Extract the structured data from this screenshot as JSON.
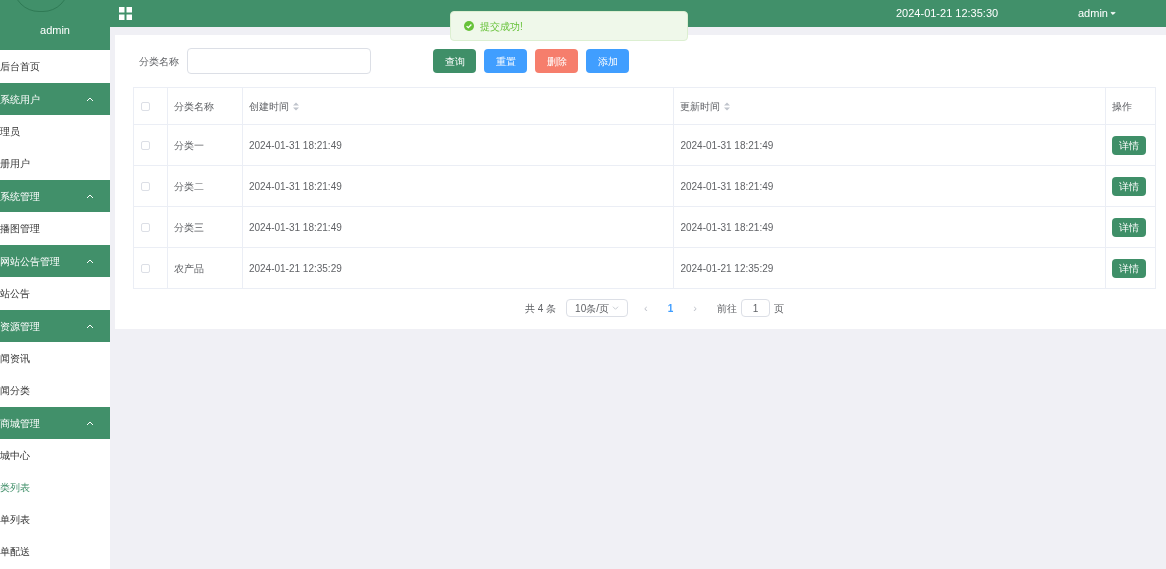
{
  "sidebar": {
    "user": "admin",
    "items": [
      {
        "kind": "link",
        "label": "后台首页",
        "selected": false
      },
      {
        "kind": "group",
        "label": "系统用户",
        "expanded": true
      },
      {
        "kind": "link",
        "label": "理员",
        "selected": false
      },
      {
        "kind": "link",
        "label": "册用户",
        "selected": false
      },
      {
        "kind": "group",
        "label": "系统管理",
        "expanded": true
      },
      {
        "kind": "link",
        "label": "播图管理",
        "selected": false
      },
      {
        "kind": "group",
        "label": "网站公告管理",
        "expanded": true
      },
      {
        "kind": "link",
        "label": "站公告",
        "selected": false
      },
      {
        "kind": "group",
        "label": "资源管理",
        "expanded": true
      },
      {
        "kind": "link",
        "label": "闻资讯",
        "selected": false
      },
      {
        "kind": "link",
        "label": "闻分类",
        "selected": false
      },
      {
        "kind": "group",
        "label": "商城管理",
        "expanded": true
      },
      {
        "kind": "link",
        "label": "城中心",
        "selected": false
      },
      {
        "kind": "link",
        "label": "类列表",
        "selected": true
      },
      {
        "kind": "link",
        "label": "单列表",
        "selected": false
      },
      {
        "kind": "link",
        "label": "单配送",
        "selected": false
      }
    ]
  },
  "header": {
    "datetime": "2024-01-21 12:35:30",
    "user": "admin"
  },
  "toast": {
    "message": "提交成功!"
  },
  "search": {
    "label": "分类名称"
  },
  "buttons": [
    {
      "label": "查询",
      "kind": "primary"
    },
    {
      "label": "重置",
      "kind": "info"
    },
    {
      "label": "删除",
      "kind": "danger"
    },
    {
      "label": "添加",
      "kind": "info"
    }
  ],
  "table": {
    "all_checked": false,
    "columns": [
      {
        "label": "分类名称",
        "sortable": false
      },
      {
        "label": "创建时间",
        "sortable": true
      },
      {
        "label": "更新时间",
        "sortable": true
      },
      {
        "label": "操作",
        "sortable": false
      }
    ],
    "rows": [
      {
        "checked": false,
        "name": "分类一",
        "created": "2024-01-31 18:21:49",
        "updated": "2024-01-31 18:21:49",
        "action": "详情"
      },
      {
        "checked": false,
        "name": "分类二",
        "created": "2024-01-31 18:21:49",
        "updated": "2024-01-31 18:21:49",
        "action": "详情"
      },
      {
        "checked": false,
        "name": "分类三",
        "created": "2024-01-31 18:21:49",
        "updated": "2024-01-31 18:21:49",
        "action": "详情"
      },
      {
        "checked": false,
        "name": "农产品",
        "created": "2024-01-21 12:35:29",
        "updated": "2024-01-21 12:35:29",
        "action": "详情"
      }
    ]
  },
  "pagination": {
    "total": "共 4 条",
    "page_size": "10条/页",
    "prev": "‹",
    "page": "1",
    "next": "›",
    "goto_label": "前往",
    "goto_value": "1",
    "goto_suffix": "页"
  }
}
